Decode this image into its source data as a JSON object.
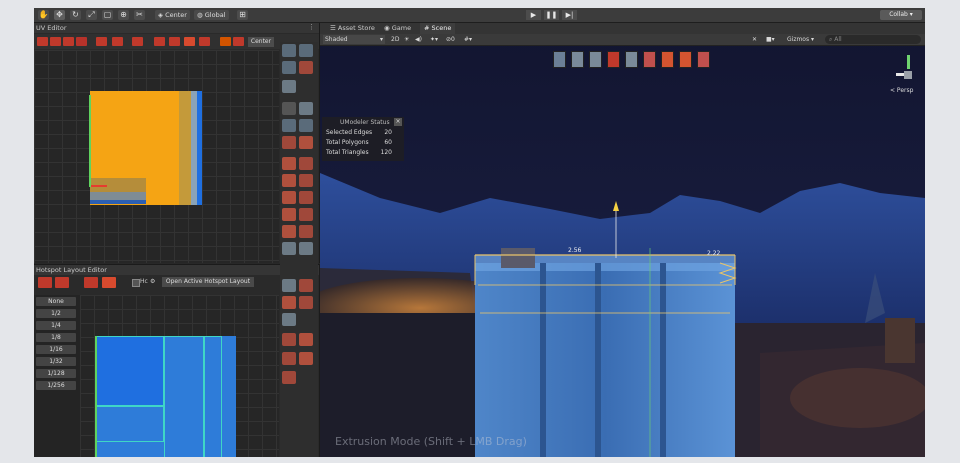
{
  "toolbar": {
    "pivot_label": "Center",
    "space_label": "Global",
    "collab_label": "Collab ▾"
  },
  "uv_editor": {
    "title": "UV Editor",
    "center_label": "Center"
  },
  "hotspot_editor": {
    "title": "Hotspot Layout Editor",
    "open_button": "Open Active Hotspot Layout",
    "hc_label": "Hc",
    "sizes": [
      "None",
      "1/2",
      "1/4",
      "1/8",
      "1/16",
      "1/32",
      "1/128",
      "1/256"
    ]
  },
  "scene": {
    "tabs": [
      {
        "icon": "☰",
        "label": "Asset Store"
      },
      {
        "icon": "◉",
        "label": "Game"
      },
      {
        "icon": "#",
        "label": "Scene"
      }
    ],
    "shading_mode": "Shaded",
    "view_2d": "2D",
    "gizmos_label": "Gizmos",
    "search_placeholder": "All",
    "perspective_label": "< Persp",
    "status_panel": {
      "title": "UModeler Status",
      "rows": [
        {
          "label": "Selected Edges",
          "value": "20"
        },
        {
          "label": "Total Polygons",
          "value": "60"
        },
        {
          "label": "Total Triangles",
          "value": "120"
        }
      ]
    },
    "dim_labels": [
      "2.56",
      "2.22"
    ],
    "mode_hint": "Extrusion Mode (Shift + LMB Drag)"
  }
}
